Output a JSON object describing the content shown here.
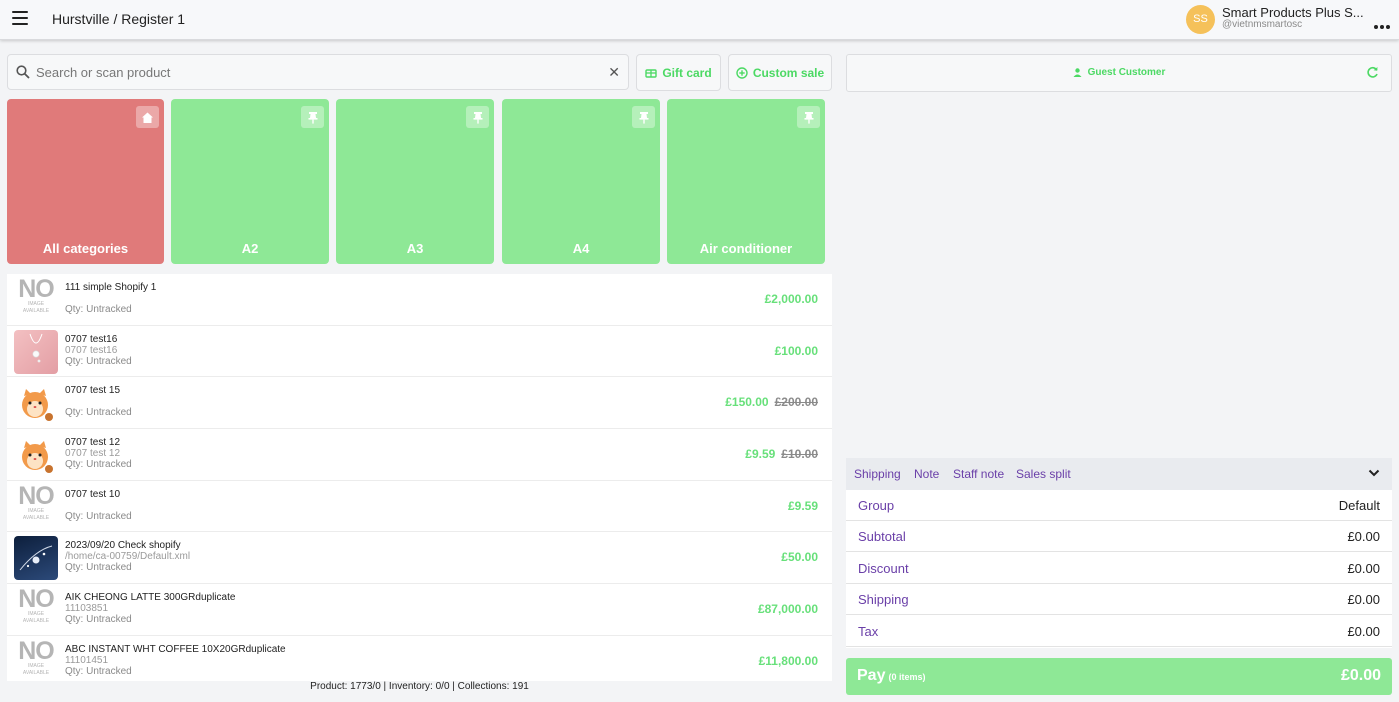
{
  "header": {
    "breadcrumb": "Hurstville / Register 1",
    "avatar_initials": "SS",
    "store_name": "Smart Products Plus S...",
    "store_handle": "@vietnmsmartosc",
    "avatar_color": "#f5c15a"
  },
  "search": {
    "placeholder": "Search or scan product"
  },
  "actions": {
    "gift_card": "Gift card",
    "custom_sale": "Custom sale"
  },
  "categories": [
    {
      "label": "All categories",
      "icon": "home-icon",
      "color": "#e07a7a"
    },
    {
      "label": "A2",
      "icon": "pin-icon",
      "color": "#8ee896"
    },
    {
      "label": "A3",
      "icon": "pin-icon",
      "color": "#8ee896"
    },
    {
      "label": "A4",
      "icon": "pin-icon",
      "color": "#8ee896"
    },
    {
      "label": "Air conditioner",
      "icon": "pin-icon",
      "color": "#8ee896"
    }
  ],
  "no_image": {
    "big": "NO",
    "mid": "IMAGE",
    "small": "AVAILABLE"
  },
  "products": [
    {
      "name": "111 simple Shopify 1",
      "sku": "",
      "qty": "Qty: Untracked",
      "price": "£2,000.00",
      "old_price": "",
      "thumb": "no-image"
    },
    {
      "name": "0707 test16",
      "sku": "0707 test16",
      "qty": "Qty: Untracked",
      "price": "£100.00",
      "old_price": "",
      "thumb": "necklace"
    },
    {
      "name": "0707 test 15",
      "sku": "",
      "qty": "Qty: Untracked",
      "price": "£150.00",
      "old_price": "£200.00",
      "thumb": "cat"
    },
    {
      "name": "0707 test 12",
      "sku": "0707 test 12",
      "qty": "Qty: Untracked",
      "price": "£9.59",
      "old_price": "£10.00",
      "thumb": "cat"
    },
    {
      "name": "0707 test 10",
      "sku": "",
      "qty": "Qty: Untracked",
      "price": "£9.59",
      "old_price": "",
      "thumb": "no-image"
    },
    {
      "name": "2023/09/20 Check shopify",
      "sku": "/home/ca-00759/Default.xml",
      "qty": "Qty: Untracked",
      "price": "£50.00",
      "old_price": "",
      "thumb": "jewelry"
    },
    {
      "name": "AIK CHEONG LATTE 300GRduplicate",
      "sku": "11103851",
      "qty": "Qty: Untracked",
      "price": "£87,000.00",
      "old_price": "",
      "thumb": "no-image"
    },
    {
      "name": "ABC INSTANT WHT COFFEE 10X20GRduplicate",
      "sku": "11101451",
      "qty": "Qty: Untracked",
      "price": "£11,800.00",
      "old_price": "",
      "thumb": "no-image"
    }
  ],
  "footer": {
    "stats": "Product: 1773/0 | Inventory: 0/0 | Collections: 191"
  },
  "customer": {
    "label": "Guest Customer"
  },
  "tabs": [
    "Shipping",
    "Note",
    "Staff note",
    "Sales split"
  ],
  "summary": [
    {
      "label": "Group",
      "value": "Default"
    },
    {
      "label": "Subtotal",
      "value": "£0.00"
    },
    {
      "label": "Discount",
      "value": "£0.00"
    },
    {
      "label": "Shipping",
      "value": "£0.00"
    },
    {
      "label": "Tax",
      "value": "£0.00"
    }
  ],
  "pay": {
    "label": "Pay",
    "items": "(0 items)",
    "total": "£0.00"
  },
  "colors": {
    "accent_green": "#4cd964",
    "price_green": "#67e07a",
    "tile_green": "#8ee896",
    "tile_red": "#e07a7a",
    "purple": "#6a3fa8"
  }
}
